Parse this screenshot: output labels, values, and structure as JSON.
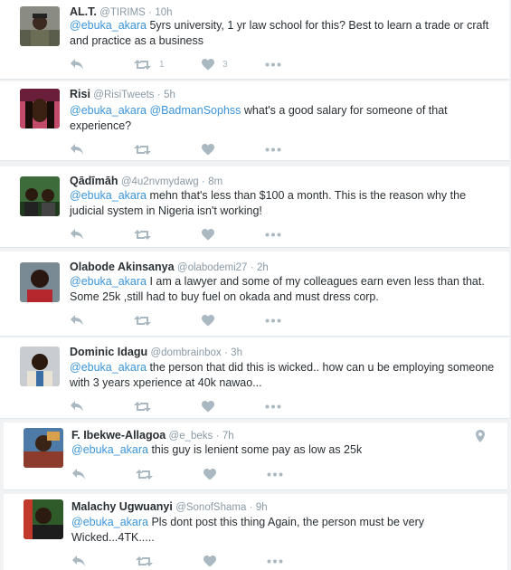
{
  "colors": {
    "mention": "#3b94d9",
    "meta": "#8899a6",
    "icon": "#aab8c2",
    "divider": "#e1e8ed"
  },
  "tweets": [
    {
      "name": "AL.T.",
      "handle": "@TIRIMS",
      "time": "10h",
      "mentions": [
        "@ebuka_akara"
      ],
      "text": "5yrs university, 1 yr law school for this? Best to learn a trade or craft and practice as a business",
      "retweets": "1",
      "likes": "3"
    },
    {
      "name": "Risi",
      "handle": "@RisiTweets",
      "time": "5h",
      "mentions": [
        "@ebuka_akara",
        "@BadmanSophss"
      ],
      "text": "what's a good salary for someone of that experience?",
      "retweets": "",
      "likes": ""
    },
    {
      "name": "Qādīmāh",
      "handle": "@4u2nvmydawg",
      "time": "8m",
      "mentions": [
        "@ebuka_akara"
      ],
      "text": "mehn that's less than $100 a month. This is the reason why the judicial system in Nigeria isn't working!",
      "retweets": "",
      "likes": ""
    },
    {
      "name": "Olabode Akinsanya",
      "handle": "@olabodemi27",
      "time": "2h",
      "mentions": [
        "@ebuka_akara"
      ],
      "text": "I am a lawyer and some of my colleagues earn even less than that. Some 25k ,still had to buy fuel on okada and must dress corp.",
      "retweets": "",
      "likes": ""
    },
    {
      "name": "Dominic Idagu",
      "handle": "@dombrainbox",
      "time": "3h",
      "mentions": [
        "@ebuka_akara"
      ],
      "text": "the person that did this is wicked.. how can u be employing someone with 3 years xperience at 40k nawao...",
      "retweets": "",
      "likes": ""
    },
    {
      "name": "F. Ibekwe-Allagoa",
      "handle": "@e_beks",
      "time": "7h",
      "mentions": [
        "@ebuka_akara"
      ],
      "text": "this guy is lenient some pay as low as 25k",
      "retweets": "",
      "likes": ""
    },
    {
      "name": "Malachy Ugwuanyi",
      "handle": "@SonofShama",
      "time": "9h",
      "mentions": [
        "@ebuka_akara"
      ],
      "text": "Pls dont post this thing Again, the person must be very Wicked...4TK.....",
      "retweets": "",
      "likes": ""
    }
  ],
  "icons": {
    "reply": "reply-icon",
    "retweet": "retweet-icon",
    "like": "heart-icon",
    "more": "more-icon",
    "location": "location-pin-icon"
  }
}
